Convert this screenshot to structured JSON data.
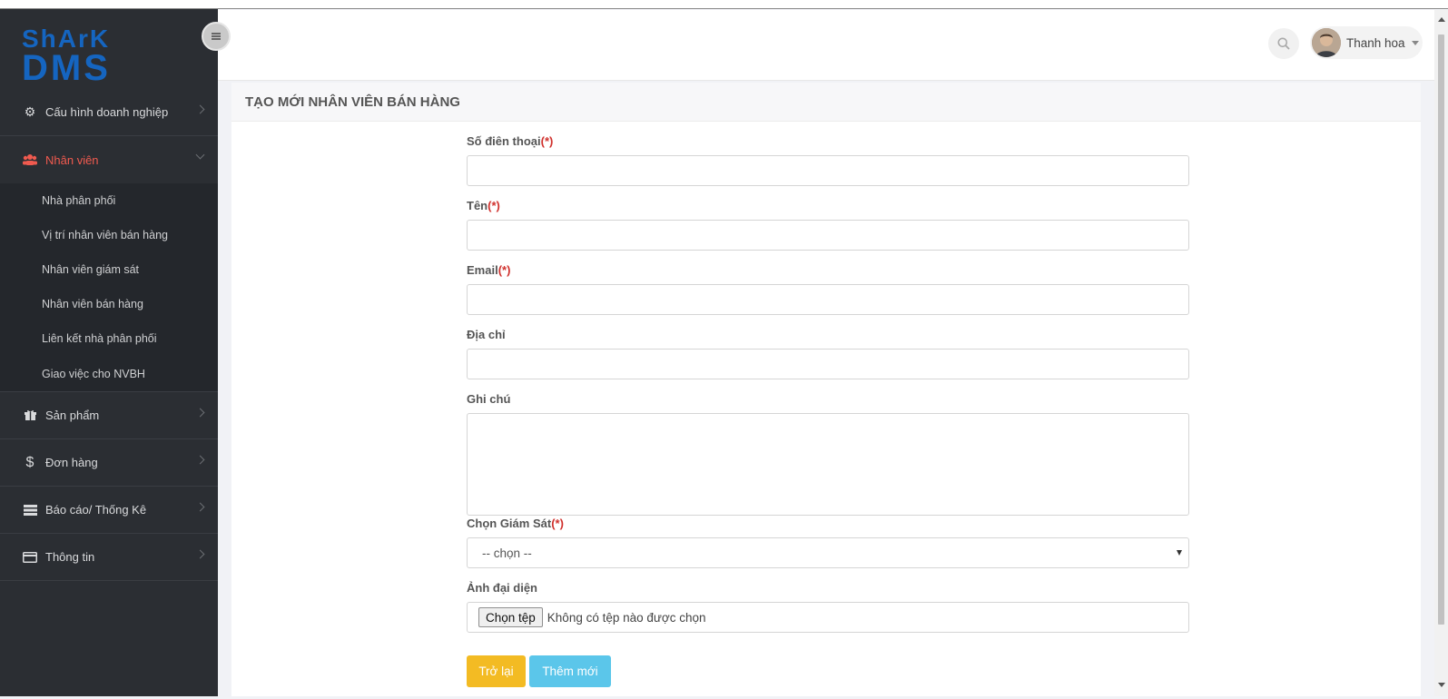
{
  "logo": {
    "text_top": "ShArK",
    "text_bottom": "DMS",
    "color": "#1565c0"
  },
  "sidebar": {
    "items": [
      {
        "label": "Cấu hình doanh nghiệp",
        "icon": "gears-icon"
      },
      {
        "label": "Nhân viên",
        "icon": "users-icon",
        "active": true
      },
      {
        "label": "Sản phẩm",
        "icon": "gift-icon"
      },
      {
        "label": "Đơn hàng",
        "icon": "dollar-icon"
      },
      {
        "label": "Báo cáo/ Thống Kê",
        "icon": "server-icon"
      },
      {
        "label": "Thông tin",
        "icon": "credit-card-icon"
      }
    ],
    "subitems": [
      {
        "label": "Nhà phân phối"
      },
      {
        "label": "Vị trí nhân viên bán hàng"
      },
      {
        "label": "Nhân viên giám sát"
      },
      {
        "label": "Nhân viên bán hàng"
      },
      {
        "label": "Liên kết nhà phân phối"
      },
      {
        "label": "Giao việc cho NVBH"
      }
    ]
  },
  "header": {
    "user_name": "Thanh hoa"
  },
  "page": {
    "title": "TẠO MỚI NHÂN VIÊN BÁN HÀNG"
  },
  "form": {
    "required_mark": "(*)",
    "phone_label": "Số điên thoại",
    "name_label": "Tên",
    "email_label": "Email",
    "address_label": "Địa chỉ",
    "note_label": "Ghi chú",
    "supervisor_label": "Chọn Giám Sát",
    "supervisor_value": "-- chọn --",
    "avatar_label": "Ảnh đại diện",
    "file_button": "Chọn tệp",
    "file_status": "Không có tệp nào được chọn"
  },
  "buttons": {
    "back": "Trở lại",
    "add": "Thêm mới"
  },
  "colors": {
    "accent_active": "#f05a4f",
    "warning": "#f3bb23",
    "info": "#5bc6ea",
    "required": "#d0312d"
  }
}
